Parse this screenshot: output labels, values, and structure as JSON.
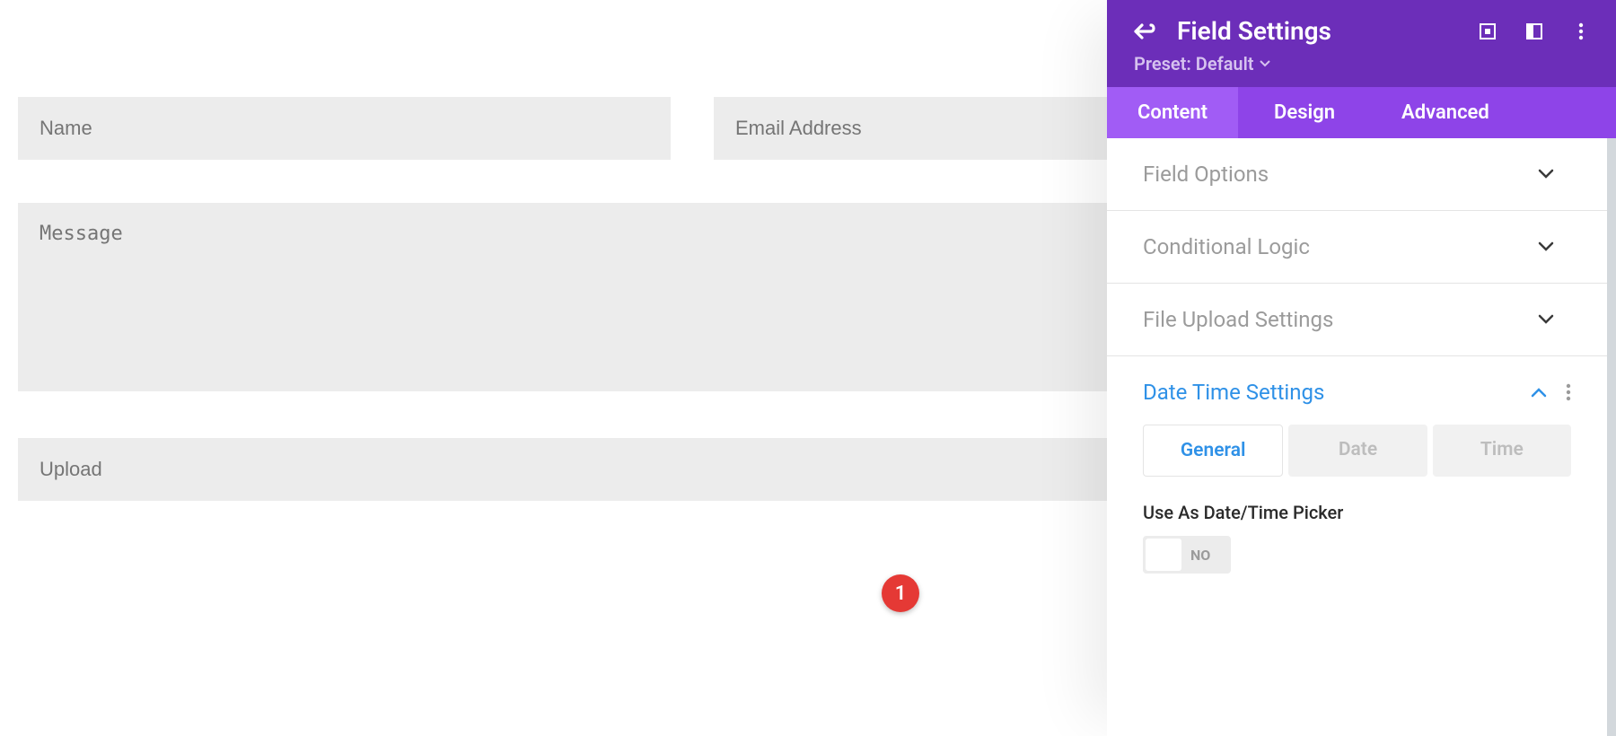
{
  "form": {
    "name_placeholder": "Name",
    "email_placeholder": "Email Address",
    "message_placeholder": "Message",
    "upload_placeholder": "Upload"
  },
  "panel": {
    "title": "Field Settings",
    "preset_label": "Preset: Default",
    "tabs": {
      "content": "Content",
      "design": "Design",
      "advanced": "Advanced",
      "active": "Content"
    },
    "sections": {
      "field_options": "Field Options",
      "conditional_logic": "Conditional Logic",
      "file_upload_settings": "File Upload Settings",
      "date_time_settings": "Date Time Settings"
    },
    "datetime": {
      "segments": {
        "general": "General",
        "date": "Date",
        "time": "Time",
        "active": "General"
      },
      "toggle_label": "Use As Date/Time Picker",
      "toggle_value": "NO"
    }
  },
  "annotation": {
    "badge1": "1"
  },
  "colors": {
    "header_purple": "#6c2eb9",
    "tabbar_purple": "#8e44e8",
    "tab_active_purple": "#a15cf5",
    "accent_blue": "#2f91e7",
    "badge_red": "#e53935",
    "field_bg": "#ececec"
  }
}
